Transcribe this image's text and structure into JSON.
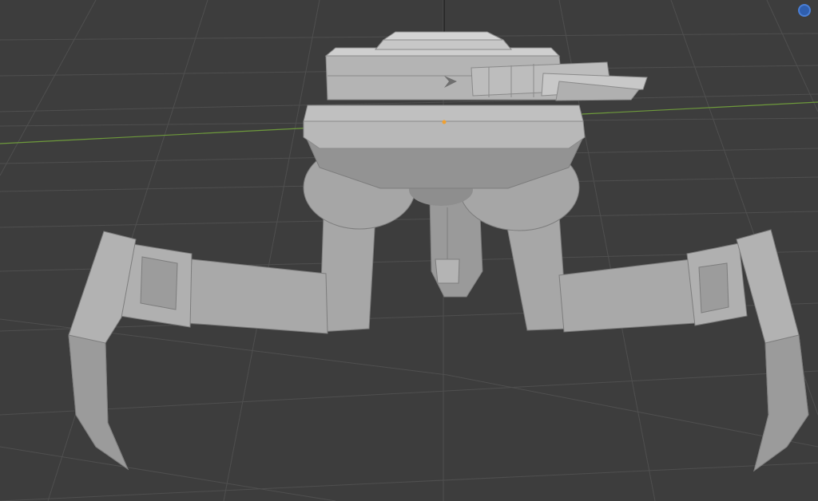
{
  "viewport": {
    "mode": "3d-viewport",
    "shading": "solid",
    "background_color": "#3d3d3d",
    "grid_color": "#4f4f4f",
    "x_axis_color": "#6e9a3c",
    "z_axis_color": "#1a1a1a",
    "origin_marker_color": "#f0a030"
  },
  "model": {
    "type": "spider-turret-mech",
    "color": "#a9a9a9",
    "parts": [
      "turret-head",
      "twin-cannon",
      "body-disc",
      "hip-spheres",
      "left-leg",
      "right-leg",
      "front-claw"
    ]
  },
  "gizmo": {
    "icon": "navigation-gizmo-icon",
    "color": "#2f5faf"
  }
}
